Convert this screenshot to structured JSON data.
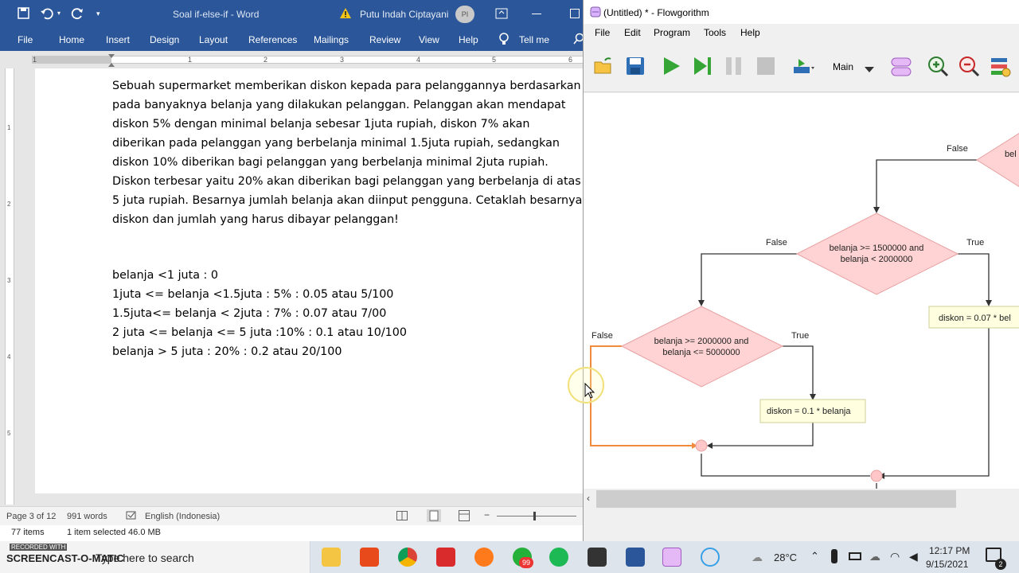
{
  "word": {
    "title": "Soal if-else-if  -  Word",
    "user": "Putu Indah Ciptayani",
    "user_initials": "PI",
    "tabs": [
      "File",
      "Home",
      "Insert",
      "Design",
      "Layout",
      "References",
      "Mailings",
      "Review",
      "View",
      "Help"
    ],
    "tell_me": "Tell me",
    "ruler_numbers": [
      "1",
      "1",
      "2",
      "3",
      "4",
      "5",
      "6"
    ],
    "vruler_numbers": [
      "1",
      "2",
      "3",
      "4",
      "5"
    ],
    "paragraph_lines": [
      "Sebuah supermarket memberikan diskon kepada para pelanggannya berdasarkan",
      "pada banyaknya belanja yang dilakukan pelanggan. Pelanggan akan mendapat",
      "diskon 5% dengan minimal belanja sebesar 1juta rupiah, diskon 7% akan",
      "diberikan pada pelanggan yang berbelanja minimal 1.5juta rupiah, sedangkan",
      "diskon 10% diberikan bagi pelanggan yang berbelanja minimal 2juta rupiah.",
      "Diskon terbesar yaitu 20% akan diberikan bagi pelanggan yang berbelanja di atas",
      "5 juta rupiah. Besarnya jumlah belanja akan diinput pengguna. Cetaklah besarnya",
      "diskon dan jumlah yang harus dibayar pelanggan!"
    ],
    "formula_lines": [
      "belanja <1 juta : 0",
      "1juta <= belanja <1.5juta : 5% : 0.05 atau 5/100",
      "1.5juta<= belanja < 2juta : 7% : 0.07 atau 7/00",
      "2 juta <= belanja <= 5 juta :10% : 0.1 atau 10/100",
      "belanja > 5 juta : 20% : 0.2 atau 20/100"
    ],
    "status": {
      "page": "Page 3 of 12",
      "words": "991 words",
      "language": "English (Indonesia)"
    }
  },
  "flowgorithm": {
    "title": "(Untitled) * - Flowgorithm",
    "menu": [
      "File",
      "Edit",
      "Program",
      "Tools",
      "Help"
    ],
    "function_select": "Main",
    "flow": {
      "decision_top_label": "bel",
      "decision_mid_lines": [
        "belanja >= 1500000 and",
        "belanja < 2000000"
      ],
      "decision_low_lines": [
        "belanja >= 2000000 and",
        "belanja <= 5000000"
      ],
      "false_label": "False",
      "true_label": "True",
      "assign_07": "diskon = 0.07 * bel",
      "assign_01": "diskon = 0.1 * belanja"
    }
  },
  "explorer": {
    "items": "77 items",
    "selected": "1 item selected  46.0 MB"
  },
  "taskbar": {
    "search_placeholder": "Type here to search",
    "recorded_with": "RECORDED WITH",
    "screencast": "SCREENCAST-O-MATIC",
    "badge_count": "99",
    "temperature": "28°C",
    "time": "12:17 PM",
    "date": "9/15/2021",
    "notification_count": "2"
  },
  "colors": {
    "word_blue": "#2b579a",
    "decision_fill": "#ffd3d3",
    "decision_stroke": "#e8a0a0",
    "assign_fill": "#ffffe0",
    "highlight_path": "#f08a3c"
  }
}
